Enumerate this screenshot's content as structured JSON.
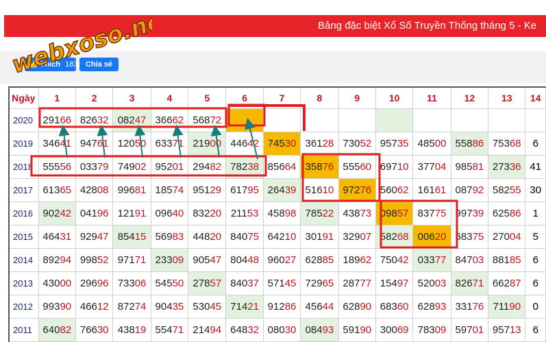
{
  "header": {
    "title": "Bảng đặc biệt Xổ Số Truyền Thống tháng 5 - Ke"
  },
  "logo": {
    "text": "webxoso.net"
  },
  "social": {
    "like_label": "Thích",
    "like_count": "183K",
    "share_label": "Chia sẻ"
  },
  "colors": {
    "red": "#e8232a",
    "highlight": "#f6b800",
    "green_cell": "#e3f1df",
    "annotation": "#e02020",
    "arrow": "#1b7a7a"
  },
  "table": {
    "day_header": "Ngày",
    "columns": [
      "1",
      "2",
      "3",
      "4",
      "5",
      "6",
      "7",
      "8",
      "9",
      "10",
      "11",
      "12",
      "13",
      "14"
    ],
    "rows": [
      {
        "year": "2020",
        "cells": [
          {
            "v": "29166",
            "s": ""
          },
          {
            "v": "82632",
            "s": ""
          },
          {
            "v": "08247",
            "s": "g"
          },
          {
            "v": "36662",
            "s": ""
          },
          {
            "v": "56872",
            "s": ""
          },
          {
            "v": "",
            "s": "o"
          },
          {
            "v": "",
            "s": ""
          },
          {
            "v": "",
            "s": ""
          },
          {
            "v": "",
            "s": ""
          },
          {
            "v": "",
            "s": "g"
          },
          {
            "v": "",
            "s": ""
          },
          {
            "v": "",
            "s": ""
          },
          {
            "v": "",
            "s": ""
          },
          {
            "v": "",
            "s": ""
          }
        ]
      },
      {
        "year": "2019",
        "cells": [
          {
            "v": "34641",
            "s": ""
          },
          {
            "v": "94761",
            "s": ""
          },
          {
            "v": "12050",
            "s": ""
          },
          {
            "v": "63371",
            "s": ""
          },
          {
            "v": "21900",
            "s": "g"
          },
          {
            "v": "44642",
            "s": ""
          },
          {
            "v": "74530",
            "s": "o"
          },
          {
            "v": "36128",
            "s": ""
          },
          {
            "v": "73052",
            "s": ""
          },
          {
            "v": "95735",
            "s": ""
          },
          {
            "v": "48500",
            "s": ""
          },
          {
            "v": "55886",
            "s": "g"
          },
          {
            "v": "75368",
            "s": ""
          },
          {
            "v": "6",
            "s": ""
          }
        ]
      },
      {
        "year": "2018",
        "cells": [
          {
            "v": "55556",
            "s": ""
          },
          {
            "v": "03379",
            "s": ""
          },
          {
            "v": "74902",
            "s": ""
          },
          {
            "v": "95201",
            "s": ""
          },
          {
            "v": "29482",
            "s": ""
          },
          {
            "v": "78238",
            "s": "g"
          },
          {
            "v": "85664",
            "s": ""
          },
          {
            "v": "35876",
            "s": "o"
          },
          {
            "v": "55560",
            "s": ""
          },
          {
            "v": "69710",
            "s": ""
          },
          {
            "v": "37704",
            "s": ""
          },
          {
            "v": "98581",
            "s": ""
          },
          {
            "v": "27336",
            "s": "g"
          },
          {
            "v": "41",
            "s": ""
          }
        ]
      },
      {
        "year": "2017",
        "cells": [
          {
            "v": "61365",
            "s": ""
          },
          {
            "v": "42808",
            "s": ""
          },
          {
            "v": "99681",
            "s": ""
          },
          {
            "v": "18574",
            "s": ""
          },
          {
            "v": "95129",
            "s": ""
          },
          {
            "v": "61795",
            "s": ""
          },
          {
            "v": "26439",
            "s": "g"
          },
          {
            "v": "51610",
            "s": ""
          },
          {
            "v": "97276",
            "s": "o"
          },
          {
            "v": "56062",
            "s": ""
          },
          {
            "v": "16161",
            "s": ""
          },
          {
            "v": "08792",
            "s": ""
          },
          {
            "v": "58255",
            "s": ""
          },
          {
            "v": "30",
            "s": ""
          }
        ]
      },
      {
        "year": "2016",
        "cells": [
          {
            "v": "90242",
            "s": "g"
          },
          {
            "v": "04196",
            "s": ""
          },
          {
            "v": "12191",
            "s": ""
          },
          {
            "v": "09640",
            "s": ""
          },
          {
            "v": "83220",
            "s": ""
          },
          {
            "v": "21153",
            "s": ""
          },
          {
            "v": "45898",
            "s": ""
          },
          {
            "v": "78522",
            "s": "g"
          },
          {
            "v": "43873",
            "s": ""
          },
          {
            "v": "09857",
            "s": "o"
          },
          {
            "v": "83775",
            "s": ""
          },
          {
            "v": "99739",
            "s": ""
          },
          {
            "v": "62586",
            "s": ""
          },
          {
            "v": "1",
            "s": ""
          }
        ]
      },
      {
        "year": "2015",
        "cells": [
          {
            "v": "46431",
            "s": ""
          },
          {
            "v": "92947",
            "s": ""
          },
          {
            "v": "85415",
            "s": "g"
          },
          {
            "v": "56983",
            "s": ""
          },
          {
            "v": "44820",
            "s": ""
          },
          {
            "v": "84075",
            "s": ""
          },
          {
            "v": "64210",
            "s": ""
          },
          {
            "v": "30191",
            "s": ""
          },
          {
            "v": "32907",
            "s": ""
          },
          {
            "v": "58268",
            "s": "g"
          },
          {
            "v": "00620",
            "s": "o"
          },
          {
            "v": "68375",
            "s": ""
          },
          {
            "v": "27004",
            "s": ""
          },
          {
            "v": "5",
            "s": ""
          }
        ]
      },
      {
        "year": "2014",
        "cells": [
          {
            "v": "89294",
            "s": ""
          },
          {
            "v": "99852",
            "s": ""
          },
          {
            "v": "97171",
            "s": ""
          },
          {
            "v": "23309",
            "s": "g"
          },
          {
            "v": "90547",
            "s": ""
          },
          {
            "v": "80448",
            "s": ""
          },
          {
            "v": "96027",
            "s": ""
          },
          {
            "v": "62885",
            "s": ""
          },
          {
            "v": "18962",
            "s": ""
          },
          {
            "v": "75042",
            "s": ""
          },
          {
            "v": "03377",
            "s": "g"
          },
          {
            "v": "84703",
            "s": ""
          },
          {
            "v": "88185",
            "s": ""
          },
          {
            "v": "6",
            "s": ""
          }
        ]
      },
      {
        "year": "2013",
        "cells": [
          {
            "v": "43000",
            "s": ""
          },
          {
            "v": "29696",
            "s": ""
          },
          {
            "v": "73306",
            "s": ""
          },
          {
            "v": "54550",
            "s": ""
          },
          {
            "v": "27857",
            "s": "g"
          },
          {
            "v": "84037",
            "s": ""
          },
          {
            "v": "57145",
            "s": ""
          },
          {
            "v": "72965",
            "s": ""
          },
          {
            "v": "28777",
            "s": ""
          },
          {
            "v": "15497",
            "s": ""
          },
          {
            "v": "52003",
            "s": ""
          },
          {
            "v": "82671",
            "s": "g"
          },
          {
            "v": "66287",
            "s": ""
          },
          {
            "v": "6",
            "s": ""
          }
        ]
      },
      {
        "year": "2012",
        "cells": [
          {
            "v": "99390",
            "s": ""
          },
          {
            "v": "46612",
            "s": ""
          },
          {
            "v": "87274",
            "s": ""
          },
          {
            "v": "90435",
            "s": ""
          },
          {
            "v": "53045",
            "s": ""
          },
          {
            "v": "71421",
            "s": "g"
          },
          {
            "v": "91286",
            "s": ""
          },
          {
            "v": "45644",
            "s": ""
          },
          {
            "v": "62890",
            "s": ""
          },
          {
            "v": "68360",
            "s": ""
          },
          {
            "v": "62893",
            "s": ""
          },
          {
            "v": "33176",
            "s": ""
          },
          {
            "v": "71190",
            "s": "g"
          },
          {
            "v": "0",
            "s": ""
          }
        ]
      },
      {
        "year": "2011",
        "cells": [
          {
            "v": "64082",
            "s": "g"
          },
          {
            "v": "76630",
            "s": ""
          },
          {
            "v": "43819",
            "s": ""
          },
          {
            "v": "55471",
            "s": ""
          },
          {
            "v": "21494",
            "s": ""
          },
          {
            "v": "64832",
            "s": ""
          },
          {
            "v": "08030",
            "s": ""
          },
          {
            "v": "08493",
            "s": "g"
          },
          {
            "v": "59190",
            "s": ""
          },
          {
            "v": "30069",
            "s": ""
          },
          {
            "v": "78309",
            "s": ""
          },
          {
            "v": "59701",
            "s": ""
          },
          {
            "v": "95713",
            "s": ""
          },
          {
            "v": "6",
            "s": ""
          }
        ]
      }
    ]
  }
}
